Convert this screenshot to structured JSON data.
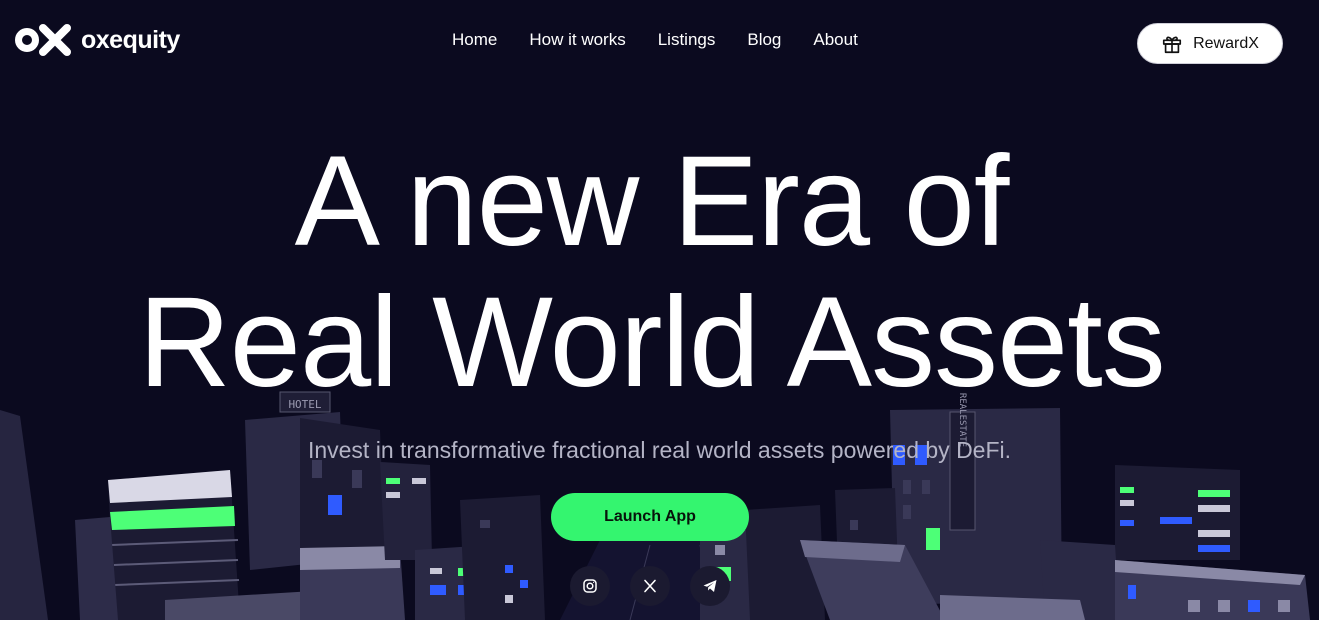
{
  "brand": {
    "name": "oxequity",
    "logo_icon": "ox-logo-icon"
  },
  "nav": {
    "items": [
      {
        "label": "Home"
      },
      {
        "label": "How it works"
      },
      {
        "label": "Listings"
      },
      {
        "label": "Blog"
      },
      {
        "label": "About"
      }
    ],
    "reward_button": {
      "label": "RewardX",
      "icon": "gift-icon"
    }
  },
  "hero": {
    "title_line1": "A new Era of",
    "title_line2": "Real World Assets",
    "subtitle": "Invest in transformative fractional real world assets powered by DeFi.",
    "cta_label": "Launch App"
  },
  "background": {
    "sign_hotel": "HOTEL",
    "sign_real_estate": "REALESTATE"
  },
  "social": [
    {
      "icon": "instagram-icon"
    },
    {
      "icon": "x-icon"
    },
    {
      "icon": "telegram-icon"
    }
  ],
  "colors": {
    "background": "#0b0a1f",
    "accent": "#34f56f",
    "window_blue": "#2f5bff",
    "subtitle": "#b4b4c6"
  }
}
